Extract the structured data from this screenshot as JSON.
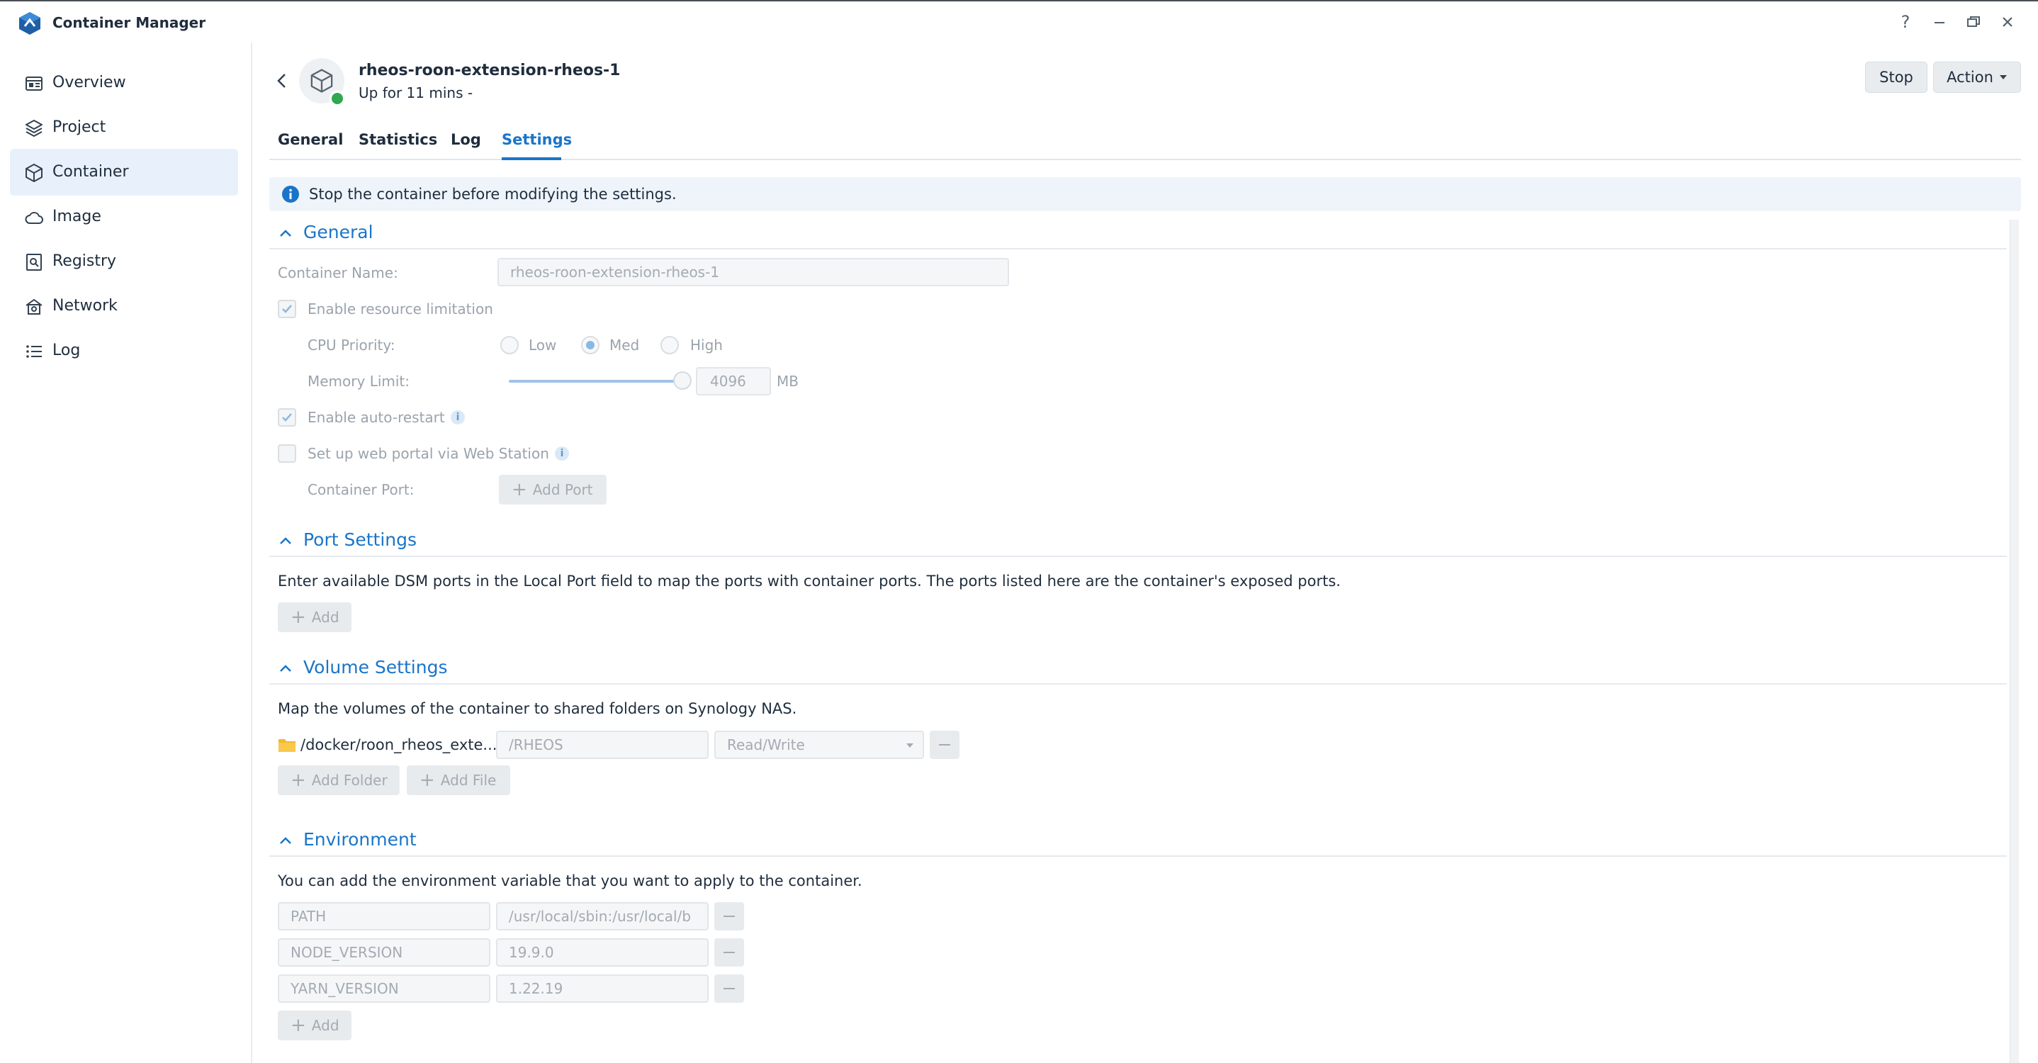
{
  "window": {
    "title": "Container Manager"
  },
  "sidebar": {
    "items": [
      {
        "label": "Overview",
        "icon": "overview-icon"
      },
      {
        "label": "Project",
        "icon": "project-icon"
      },
      {
        "label": "Container",
        "icon": "container-icon",
        "active": true
      },
      {
        "label": "Image",
        "icon": "cloud-icon"
      },
      {
        "label": "Registry",
        "icon": "registry-icon"
      },
      {
        "label": "Network",
        "icon": "network-icon"
      },
      {
        "label": "Log",
        "icon": "list-icon"
      }
    ]
  },
  "header": {
    "name": "rheos-roon-extension-rheos-1",
    "status": "Up for 11 mins -",
    "stop_label": "Stop",
    "action_label": "Action",
    "status_color": "#2fa84f"
  },
  "tabs": [
    {
      "label": "General"
    },
    {
      "label": "Statistics"
    },
    {
      "label": "Log"
    },
    {
      "label": "Settings",
      "active": true
    }
  ],
  "notice": {
    "text": "Stop the container before modifying the settings."
  },
  "general": {
    "title": "General",
    "container_name_label": "Container Name:",
    "container_name_value": "rheos-roon-extension-rheos-1",
    "resource_limit_label": "Enable resource limitation",
    "resource_limit_checked": true,
    "cpu_priority_label": "CPU Priority:",
    "cpu_options": [
      "Low",
      "Med",
      "High"
    ],
    "cpu_selected": "Med",
    "memory_limit_label": "Memory Limit:",
    "memory_value": "4096",
    "memory_unit": "MB",
    "memory_slider_fraction": 1.0,
    "auto_restart_label": "Enable auto-restart",
    "auto_restart_checked": true,
    "web_portal_label": "Set up web portal via Web Station",
    "web_portal_checked": false,
    "container_port_label": "Container Port:",
    "add_port_label": "Add Port"
  },
  "ports": {
    "title": "Port Settings",
    "description": "Enter available DSM ports in the Local Port field to map the ports with container ports. The ports listed here are the container's exposed ports.",
    "add_label": "Add"
  },
  "volumes": {
    "title": "Volume Settings",
    "description": "Map the volumes of the container to shared folders on Synology NAS.",
    "rows": [
      {
        "folder": "/docker/roon_rheos_exte...",
        "mount": "/RHEOS",
        "mode": "Read/Write"
      }
    ],
    "add_folder_label": "Add Folder",
    "add_file_label": "Add File"
  },
  "environment": {
    "title": "Environment",
    "description": "You can add the environment variable that you want to apply to the container.",
    "vars": [
      {
        "key": "PATH",
        "value": "/usr/local/sbin:/usr/local/b"
      },
      {
        "key": "NODE_VERSION",
        "value": "19.9.0"
      },
      {
        "key": "YARN_VERSION",
        "value": "1.22.19"
      }
    ],
    "add_label": "Add"
  },
  "colors": {
    "accent": "#1a75c9",
    "active_nav_bg": "#e8f1fb"
  }
}
